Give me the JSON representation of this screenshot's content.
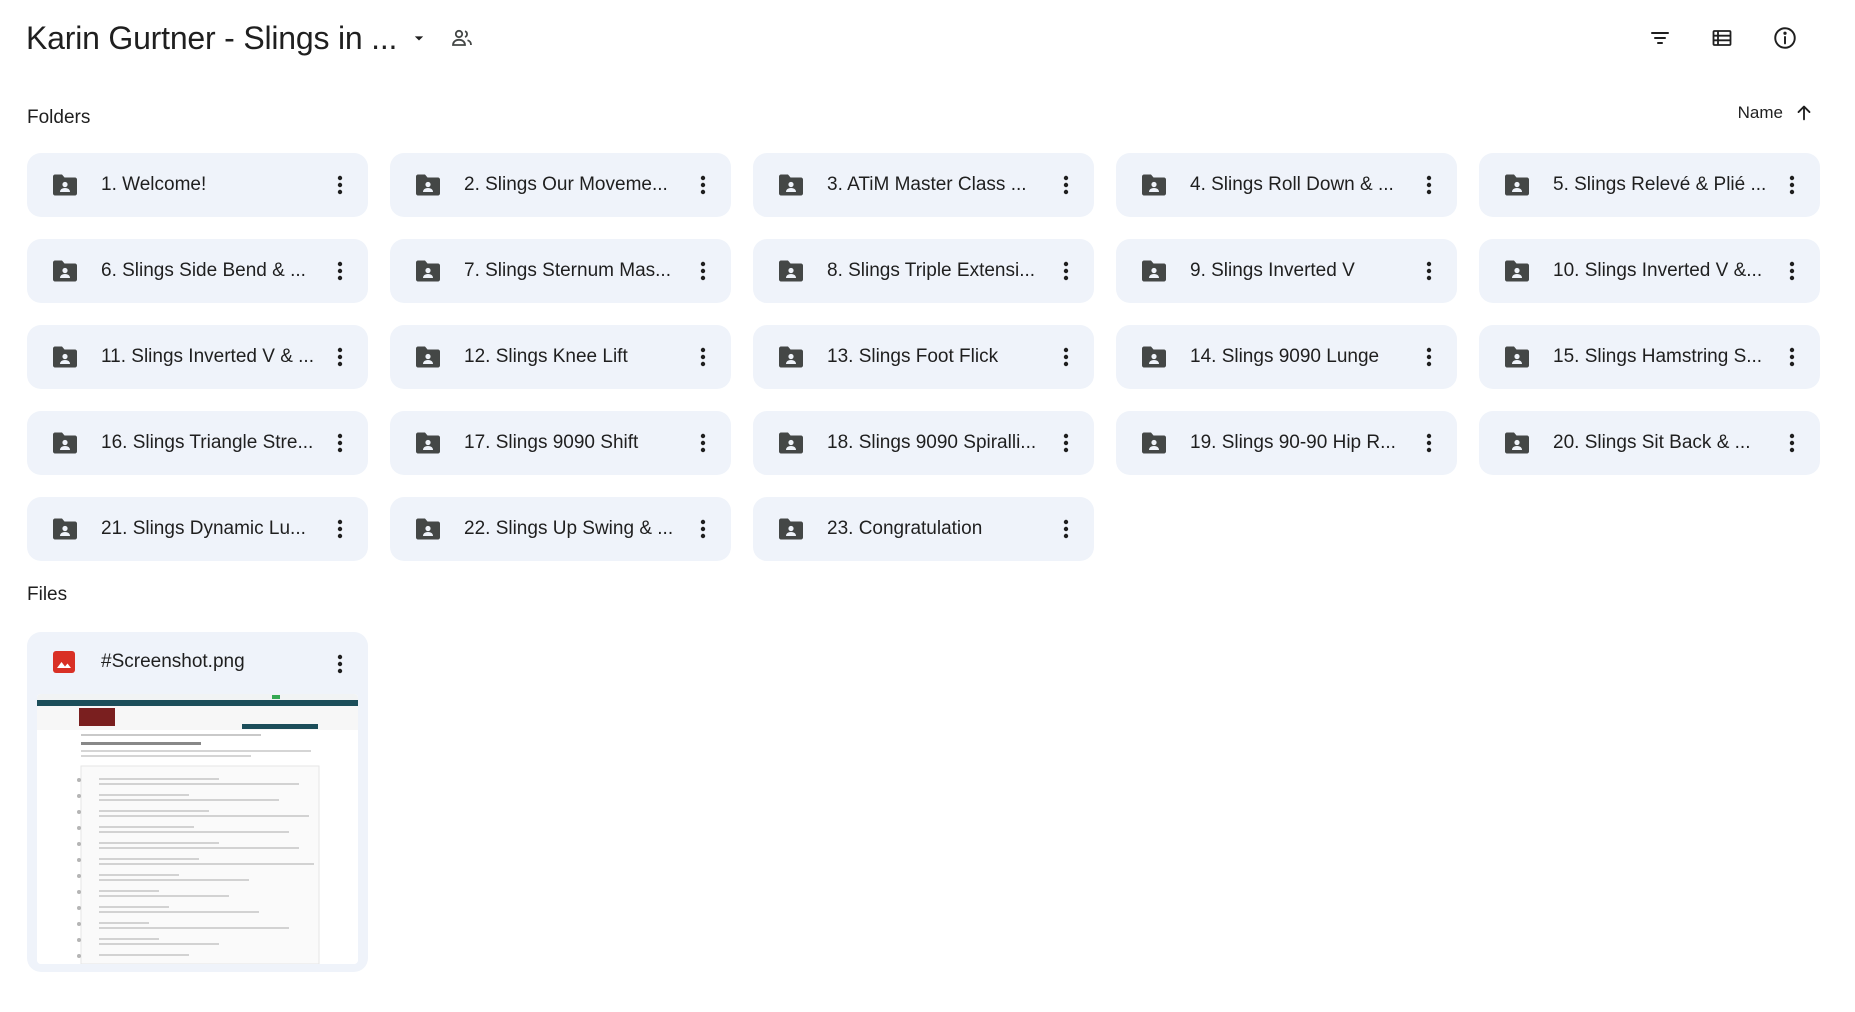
{
  "header": {
    "title": "Karin Gurtner - Slings in ..."
  },
  "sections": {
    "folders_label": "Folders",
    "files_label": "Files"
  },
  "sort": {
    "label": "Name",
    "direction": "ascending"
  },
  "folders": [
    {
      "name": "1. Welcome!"
    },
    {
      "name": "2. Slings Our Moveme..."
    },
    {
      "name": "3. ATiM Master Class ..."
    },
    {
      "name": "4. Slings Roll Down & ..."
    },
    {
      "name": "5. Slings Relevé & Plié ..."
    },
    {
      "name": "6. Slings Side Bend & ..."
    },
    {
      "name": "7. Slings Sternum Mas..."
    },
    {
      "name": "8. Slings Triple Extensi..."
    },
    {
      "name": "9. Slings Inverted V"
    },
    {
      "name": "10. Slings Inverted V &..."
    },
    {
      "name": "11. Slings Inverted V & ..."
    },
    {
      "name": "12. Slings Knee Lift"
    },
    {
      "name": "13. Slings Foot Flick"
    },
    {
      "name": "14. Slings 9090 Lunge"
    },
    {
      "name": "15. Slings Hamstring S..."
    },
    {
      "name": "16. Slings Triangle Stre..."
    },
    {
      "name": "17. Slings 9090 Shift"
    },
    {
      "name": "18. Slings 9090 Spiralli..."
    },
    {
      "name": "19. Slings 90-90 Hip R..."
    },
    {
      "name": "20. Slings Sit Back & ..."
    },
    {
      "name": "21. Slings Dynamic Lu..."
    },
    {
      "name": "22. Slings Up Swing & ..."
    },
    {
      "name": "23. Congratulation"
    }
  ],
  "files": [
    {
      "name": "#Screenshot.png",
      "icon": "image-icon"
    }
  ],
  "colors": {
    "card_bg": "#eff3fa",
    "icon_dark": "#444746",
    "image_red": "#d93025"
  }
}
